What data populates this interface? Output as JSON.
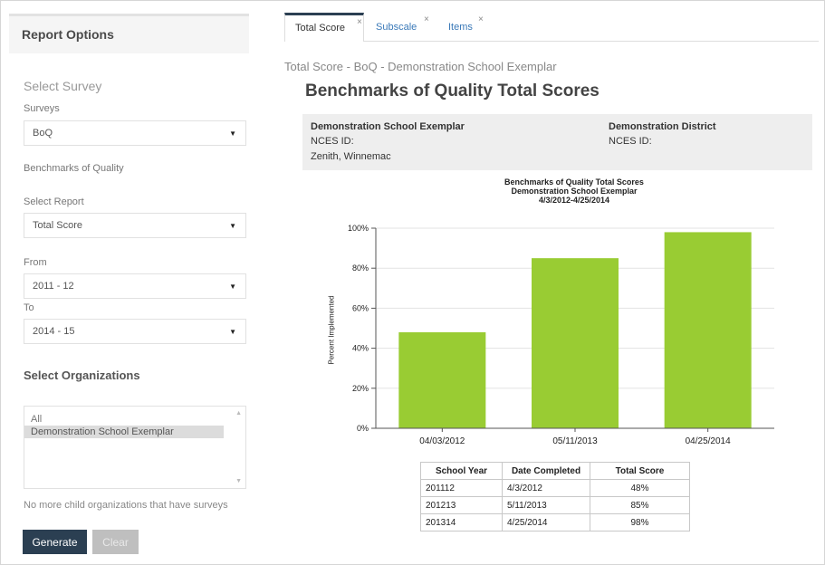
{
  "left_panel": {
    "title": "Report Options",
    "select_survey_heading": "Select Survey",
    "surveys_label": "Surveys",
    "survey_value": "BoQ",
    "survey_name": "Benchmarks of Quality",
    "select_report_label": "Select Report",
    "report_value": "Total Score",
    "from_label": "From",
    "from_value": "2011 - 12",
    "to_label": "To",
    "to_value": "2014 - 15",
    "orgs_heading": "Select Organizations",
    "org_options": [
      "All",
      "Demonstration School Exemplar"
    ],
    "no_more_note": "No more child organizations that have surveys",
    "generate_label": "Generate",
    "clear_label": "Clear"
  },
  "tabs": [
    {
      "label": "Total Score",
      "active": true
    },
    {
      "label": "Subscale",
      "active": false
    },
    {
      "label": "Items",
      "active": false
    }
  ],
  "tab_close_glyph": "×",
  "breadcrumb": "Total Score - BoQ - Demonstration School Exemplar",
  "report_title": "Benchmarks of Quality Total Scores",
  "info": {
    "school_name": "Demonstration School Exemplar",
    "school_nces": "NCES ID:",
    "school_location": "Zenith, Winnemac",
    "district_name": "Demonstration District",
    "district_nces": "NCES ID:"
  },
  "chart_data": {
    "type": "bar",
    "title": "Benchmarks of Quality Total Scores",
    "subtitle_lines": [
      "Demonstration School Exemplar",
      "4/3/2012-4/25/2014"
    ],
    "ylabel": "Percent Implemented",
    "categories": [
      "04/03/2012",
      "05/11/2013",
      "04/25/2014"
    ],
    "values": [
      48,
      85,
      98
    ],
    "ylim": [
      0,
      100
    ],
    "yticks": [
      "0%",
      "20%",
      "40%",
      "60%",
      "80%",
      "100%"
    ],
    "grid": true,
    "bar_color": "#99cc33"
  },
  "table": {
    "headers": [
      "School Year",
      "Date Completed",
      "Total Score"
    ],
    "rows": [
      [
        "201112",
        "4/3/2012",
        "48%"
      ],
      [
        "201213",
        "5/11/2013",
        "85%"
      ],
      [
        "201314",
        "4/25/2014",
        "98%"
      ]
    ]
  }
}
